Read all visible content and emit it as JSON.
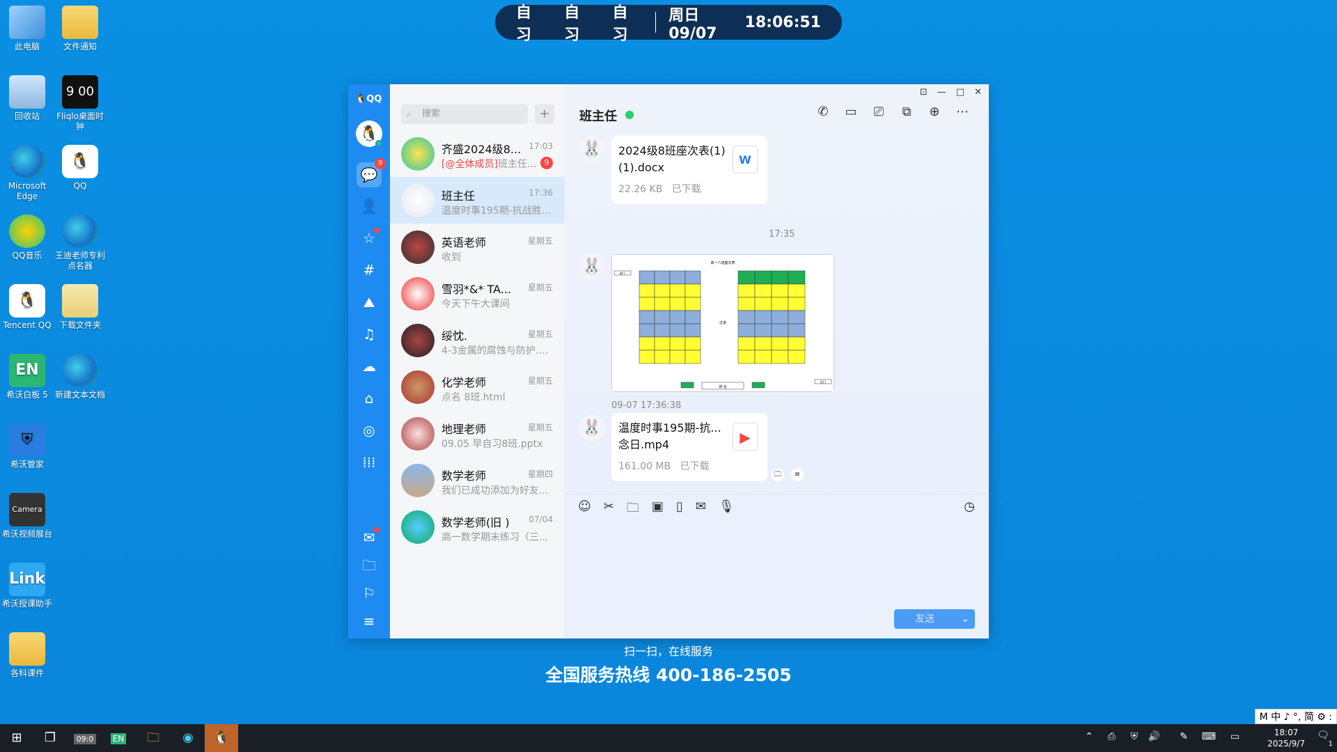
{
  "desktop": {
    "icons": [
      {
        "label": "此电脑",
        "icon": "computer-icon"
      },
      {
        "label": "文件通知",
        "icon": "folder-warning-icon"
      },
      {
        "label": "回收站",
        "icon": "recycle-bin-icon"
      },
      {
        "label": "Fliqlo桌面时钟",
        "icon": "clock-icon"
      },
      {
        "label": "Microsoft Edge",
        "icon": "edge-icon"
      },
      {
        "label": "QQ",
        "icon": "qq-penguin-icon"
      },
      {
        "label": "QQ音乐",
        "icon": "qq-music-icon"
      },
      {
        "label": "王迪老师专利点名器",
        "icon": "edge-icon"
      },
      {
        "label": "Tencent QQ",
        "icon": "qq-penguin-icon"
      },
      {
        "label": "下载文件夹",
        "icon": "folder-zip-icon"
      },
      {
        "label": "希沃白板 5",
        "icon": "easinote-icon"
      },
      {
        "label": "新建文本文档",
        "icon": "edge-icon"
      },
      {
        "label": "希沃管家",
        "icon": "shield-icon"
      },
      {
        "label": "希沃视频展台",
        "icon": "camera-icon"
      },
      {
        "label": "希沃授课助手",
        "icon": "link-icon"
      },
      {
        "label": "各科课件",
        "icon": "folder-icon"
      }
    ],
    "fliqlo_time": "9 00"
  },
  "topbar": {
    "subjects": [
      "自习",
      "自习",
      "自习"
    ],
    "date": "周日 09/07",
    "time": "18:06:51"
  },
  "qq": {
    "logo": "QQ",
    "rail_badge": "9",
    "search_placeholder": "搜索",
    "chats": [
      {
        "name": "齐盛2024级8...",
        "time": "17:03",
        "preview_mention": "[@全体成员]",
        "preview": "班主任...",
        "badge": "9"
      },
      {
        "name": "班主任",
        "time": "17:36",
        "preview": "温度时事195期-抗战胜..."
      },
      {
        "name": "英语老师",
        "time": "星期五",
        "preview": "收到"
      },
      {
        "name": "雪羽*&* TA...",
        "time": "星期五",
        "preview": "今天下午大课间"
      },
      {
        "name": "绥忱.",
        "time": "星期五",
        "preview": "4-3金属的腐蚀与防护.p..."
      },
      {
        "name": "化学老师",
        "time": "星期五",
        "preview": "点名 8班.html"
      },
      {
        "name": "地理老师",
        "time": "星期五",
        "preview": "09.05 早自习8班.pptx"
      },
      {
        "name": "数学老师",
        "time": "星期四",
        "preview": "我们已成功添加为好友..."
      },
      {
        "name": "数学老师(旧 )",
        "time": "07/04",
        "preview": "高一数学期末练习（三..."
      }
    ],
    "chat_title": "班主任",
    "messages": {
      "file1_name": "2024级8班座次表(1)(1).docx",
      "file1_size": "22.26 KB",
      "file1_status": "已下载",
      "file1_icon": "W",
      "time_divider": "17:35",
      "image_caption": "高一八班座次表",
      "image_ts": "09-07 17:36:38",
      "image_podium": "讲 台",
      "image_door_left": "前门",
      "image_door_right": "后门",
      "image_aisle": "过道",
      "file2_name": "温度时事195期-抗...念日.mp4",
      "file2_size": "161.00 MB",
      "file2_status": "已下载"
    },
    "send_label": "发送"
  },
  "caption": {
    "line1": "扫一扫，在线服务",
    "line2": "全国服务热线 400-186-2505"
  },
  "taskbar": {
    "clock_time": "18:07",
    "clock_date": "2025/9/7",
    "notification_count": "1",
    "ime": "M 中 ♪ °, 简 ⚙ :"
  },
  "colors": {
    "desktop_bg": "#0a8fe3",
    "qq_rail": "#1d8bf1",
    "selected_chat": "#d8e9fc",
    "online_dot": "#2ccf6b",
    "badge_red": "#f44444"
  }
}
